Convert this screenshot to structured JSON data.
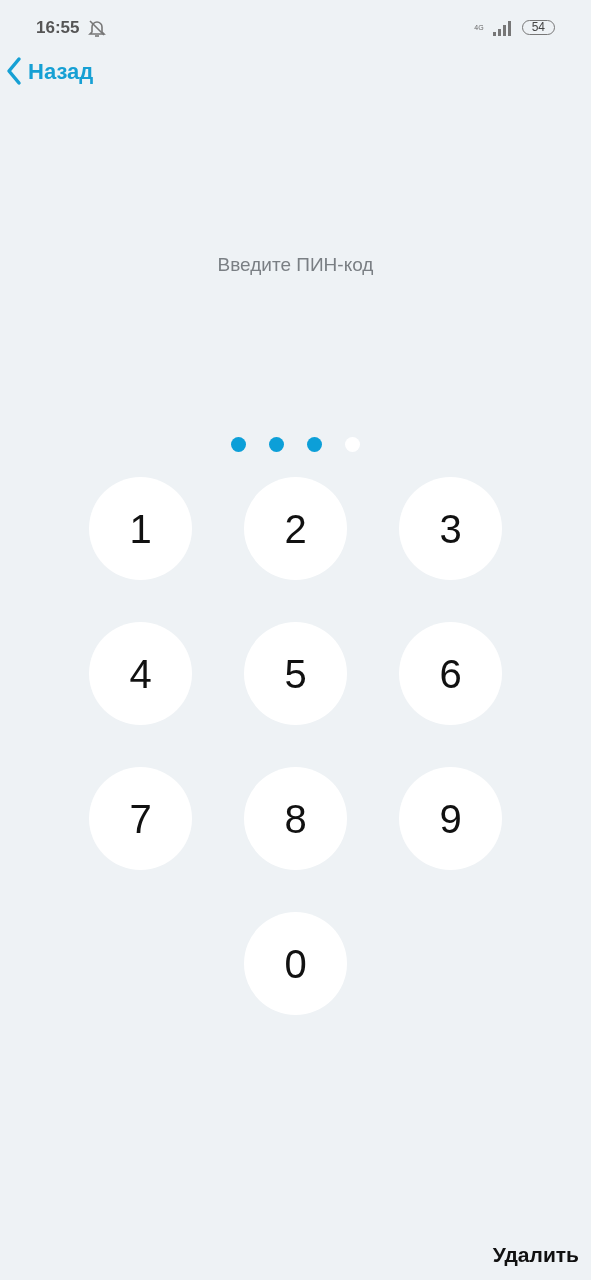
{
  "status_bar": {
    "time": "16:55",
    "network": "4G",
    "battery": "54"
  },
  "nav": {
    "back_label": "Назад"
  },
  "prompt": "Введите ПИН-код",
  "pin_dots": [
    {
      "filled": true
    },
    {
      "filled": true
    },
    {
      "filled": true
    },
    {
      "filled": false
    }
  ],
  "keypad": {
    "rows": [
      [
        "1",
        "2",
        "3"
      ],
      [
        "4",
        "5",
        "6"
      ],
      [
        "7",
        "8",
        "9"
      ],
      [
        "",
        "0",
        ""
      ]
    ]
  },
  "delete_label": "Удалить"
}
